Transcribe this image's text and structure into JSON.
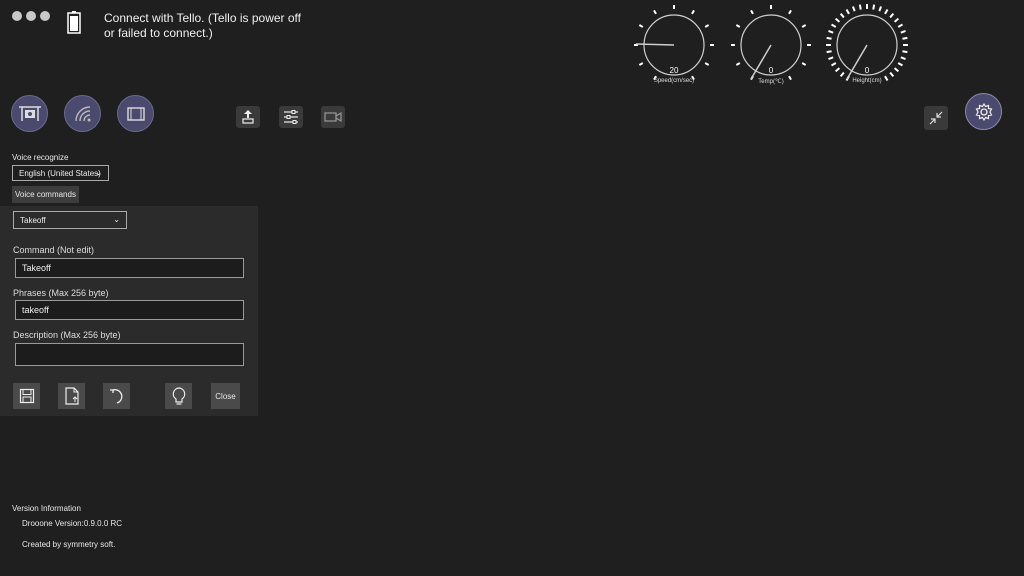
{
  "status": {
    "message": "Connect with Tello. (Tello is  power off\nor failed to connect.)"
  },
  "gauges": [
    {
      "value": "20",
      "label": "Speed(cm/sec)"
    },
    {
      "value": "0",
      "label": "Temp(℃)"
    },
    {
      "value": "0",
      "label": "Height(cm)"
    }
  ],
  "toolbar": {
    "left_buttons": [
      "drone-icon",
      "wifi-icon",
      "screen-icon"
    ],
    "mid_buttons": [
      "takeoff-icon",
      "sliders-icon",
      "camera-icon"
    ],
    "right_buttons": [
      "collapse-icon",
      "gear-icon"
    ]
  },
  "voice": {
    "label": "Voice recognize",
    "language": "English (United States)",
    "commands_button": "Voice commands"
  },
  "editor": {
    "selected_command": "Takeoff",
    "command_label": "Command (Not edit)",
    "command_value": "Takeoff",
    "phrases_label": "Phrases (Max 256 byte)",
    "phrases_value": "takeoff",
    "description_label": "Description (Max 256 byte)",
    "description_value": "",
    "close_label": "Close"
  },
  "version": {
    "heading": "Version Information",
    "version_text": "Drooone Version:0.9.0.0 RC",
    "credit": "Created by symmetry soft."
  },
  "colors": {
    "background": "#1f1f1f",
    "panel": "#2b2b2b",
    "round_button": "#4a4a6e"
  }
}
